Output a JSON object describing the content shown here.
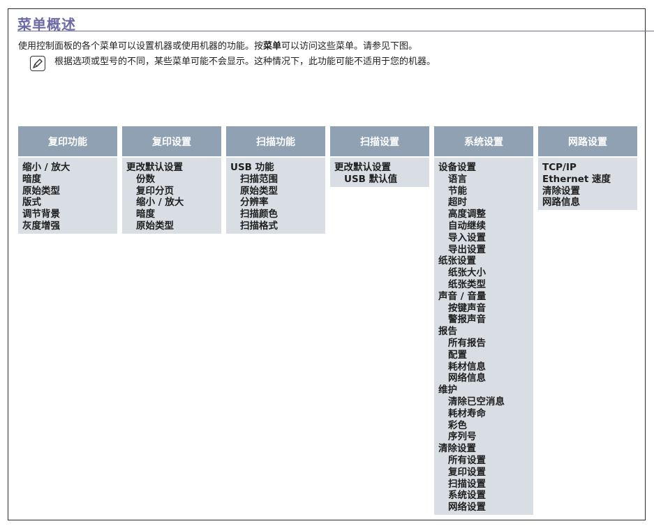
{
  "page": {
    "title": "菜单概述",
    "intro_before": "使用控制面板的各个菜单可以设置机器或使用机器的功能。按",
    "intro_bold": "菜单",
    "intro_after": "可以访问这些菜单。请参见下图。",
    "note_icon": "note-pencil-icon",
    "note_text": "根据选项或型号的不同，某些菜单可能不会显示。这种情况下，此功能可能不适用于您的机器。"
  },
  "colors": {
    "title": "#6b6aa6",
    "menu_header_bg": "#8fa1b3",
    "menu_body_bg": "#d9dee4"
  },
  "menus": [
    {
      "header": "复印功能",
      "items": [
        {
          "label": "缩小 / 放大",
          "level": 0
        },
        {
          "label": "暗度",
          "level": 0
        },
        {
          "label": "原始类型",
          "level": 0
        },
        {
          "label": "版式",
          "level": 0
        },
        {
          "label": "调节背景",
          "level": 0
        },
        {
          "label": "灰度增强",
          "level": 0
        }
      ]
    },
    {
      "header": "复印设置",
      "items": [
        {
          "label": "更改默认设置",
          "level": 0
        },
        {
          "label": "份数",
          "level": 1
        },
        {
          "label": "复印分页",
          "level": 1
        },
        {
          "label": "缩小 / 放大",
          "level": 1
        },
        {
          "label": "暗度",
          "level": 1
        },
        {
          "label": "原始类型",
          "level": 1
        }
      ]
    },
    {
      "header": "扫描功能",
      "items": [
        {
          "label": "USB 功能",
          "level": 0
        },
        {
          "label": "扫描范围",
          "level": 1
        },
        {
          "label": "原始类型",
          "level": 1
        },
        {
          "label": "分辨率",
          "level": 1
        },
        {
          "label": "扫描颜色",
          "level": 1
        },
        {
          "label": "扫描格式",
          "level": 1
        }
      ]
    },
    {
      "header": "扫描设置",
      "items": [
        {
          "label": "更改默认设置",
          "level": 0
        },
        {
          "label": "USB 默认值",
          "level": 1
        }
      ]
    },
    {
      "header": "系统设置",
      "items": [
        {
          "label": "设备设置",
          "level": 0
        },
        {
          "label": "语言",
          "level": 1
        },
        {
          "label": "节能",
          "level": 1
        },
        {
          "label": "超时",
          "level": 1
        },
        {
          "label": "高度调整",
          "level": 1
        },
        {
          "label": "自动继续",
          "level": 1
        },
        {
          "label": "导入设置",
          "level": 1
        },
        {
          "label": "导出设置",
          "level": 1
        },
        {
          "label": "纸张设置",
          "level": 0
        },
        {
          "label": "纸张大小",
          "level": 1
        },
        {
          "label": "纸张类型",
          "level": 1
        },
        {
          "label": "声音 / 音量",
          "level": 0
        },
        {
          "label": "按键声音",
          "level": 1
        },
        {
          "label": "警报声音",
          "level": 1
        },
        {
          "label": "报告",
          "level": 0
        },
        {
          "label": "所有报告",
          "level": 1
        },
        {
          "label": "配置",
          "level": 1
        },
        {
          "label": "耗材信息",
          "level": 1
        },
        {
          "label": "网络信息",
          "level": 1
        },
        {
          "label": "维护",
          "level": 0
        },
        {
          "label": "清除已空消息",
          "level": 1
        },
        {
          "label": "耗材寿命",
          "level": 1
        },
        {
          "label": "彩色",
          "level": 1
        },
        {
          "label": "序列号",
          "level": 1
        },
        {
          "label": "清除设置",
          "level": 0
        },
        {
          "label": "所有设置",
          "level": 1
        },
        {
          "label": "复印设置",
          "level": 1
        },
        {
          "label": "扫描设置",
          "level": 1
        },
        {
          "label": "系统设置",
          "level": 1
        },
        {
          "label": "网络设置",
          "level": 1
        }
      ]
    },
    {
      "header": "网路设置",
      "items": [
        {
          "label": "TCP/IP",
          "level": 0
        },
        {
          "label": "Ethernet 速度",
          "level": 0
        },
        {
          "label": "清除设置",
          "level": 0
        },
        {
          "label": "网路信息",
          "level": 0
        }
      ]
    }
  ]
}
